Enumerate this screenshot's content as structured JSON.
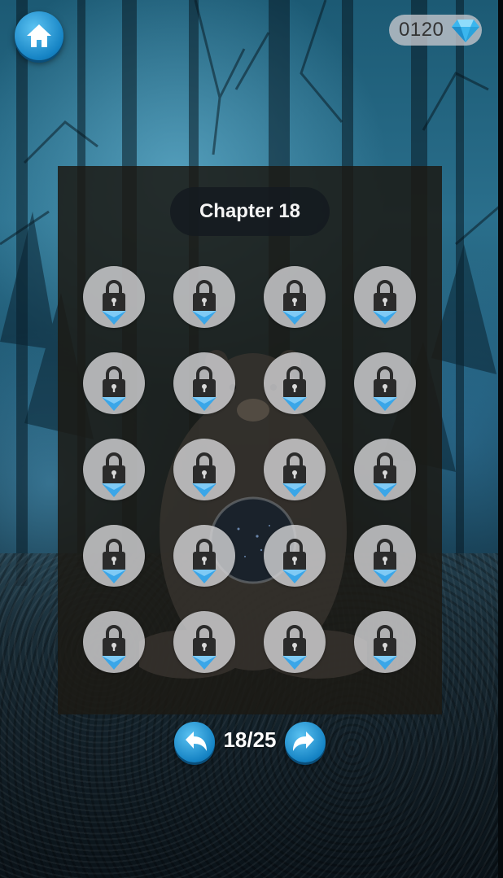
{
  "header": {
    "home_icon": "home-icon",
    "gem_count": "0120",
    "gem_icon": "diamond-icon",
    "accent_color": "#1a8fd0"
  },
  "chapter": {
    "title": "Chapter 18",
    "rows": 5,
    "columns": 4,
    "levels": [
      {
        "state": "locked",
        "icon": "padlock-icon"
      },
      {
        "state": "locked",
        "icon": "padlock-icon"
      },
      {
        "state": "locked",
        "icon": "padlock-icon"
      },
      {
        "state": "locked",
        "icon": "padlock-icon"
      },
      {
        "state": "locked",
        "icon": "padlock-icon"
      },
      {
        "state": "locked",
        "icon": "padlock-icon"
      },
      {
        "state": "locked",
        "icon": "padlock-icon"
      },
      {
        "state": "locked",
        "icon": "padlock-icon"
      },
      {
        "state": "locked",
        "icon": "padlock-icon"
      },
      {
        "state": "locked",
        "icon": "padlock-icon"
      },
      {
        "state": "locked",
        "icon": "padlock-icon"
      },
      {
        "state": "locked",
        "icon": "padlock-icon"
      },
      {
        "state": "locked",
        "icon": "padlock-icon"
      },
      {
        "state": "locked",
        "icon": "padlock-icon"
      },
      {
        "state": "locked",
        "icon": "padlock-icon"
      },
      {
        "state": "locked",
        "icon": "padlock-icon"
      },
      {
        "state": "locked",
        "icon": "padlock-icon"
      },
      {
        "state": "locked",
        "icon": "padlock-icon"
      },
      {
        "state": "locked",
        "icon": "padlock-icon"
      },
      {
        "state": "locked",
        "icon": "padlock-icon"
      }
    ]
  },
  "pagination": {
    "indicator": "18/25",
    "prev_icon": "undo-arrow-icon",
    "next_icon": "redo-arrow-icon"
  }
}
